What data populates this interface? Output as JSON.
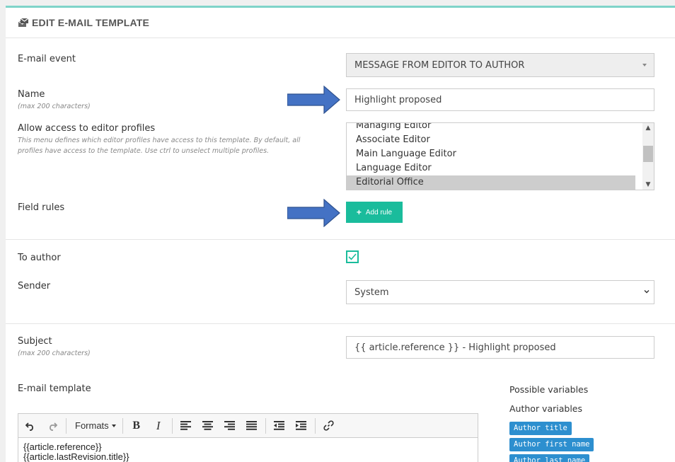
{
  "header": {
    "title": "EDIT E-MAIL TEMPLATE",
    "icon": "email-template-icon"
  },
  "email_event": {
    "label": "E-mail event",
    "value": "MESSAGE FROM EDITOR TO AUTHOR"
  },
  "name": {
    "label": "Name",
    "hint": "(max 200 characters)",
    "value": "Highlight proposed"
  },
  "access": {
    "label": "Allow access to editor profiles",
    "hint": "This menu defines which editor profiles have access to this template. By default, all profiles have access to the template. Use ctrl to unselect multiple profiles.",
    "options": [
      "Managing Editor",
      "Associate Editor",
      "Main Language Editor",
      "Language Editor",
      "Editorial Office"
    ],
    "selected": "Editorial Office"
  },
  "field_rules": {
    "label": "Field rules",
    "add_button": "Add rule"
  },
  "to_author": {
    "label": "To author",
    "checked": true
  },
  "sender": {
    "label": "Sender",
    "value": "System"
  },
  "subject": {
    "label": "Subject",
    "hint": "(max 200 characters)",
    "value": "{{ article.reference }} - Highlight proposed"
  },
  "template": {
    "label": "E-mail template",
    "formats_label": "Formats",
    "content_lines": [
      "{{article.reference}}",
      "{{article.lastRevision.title}}"
    ]
  },
  "variables": {
    "heading": "Possible variables",
    "group_label": "Author variables",
    "tags": [
      "Author title",
      "Author first name",
      "Author last name"
    ]
  },
  "colors": {
    "accent": "#1abc9c",
    "tag": "#2d8fcf",
    "arrow": "#4472c4",
    "top_border": "#7fd4c9"
  }
}
